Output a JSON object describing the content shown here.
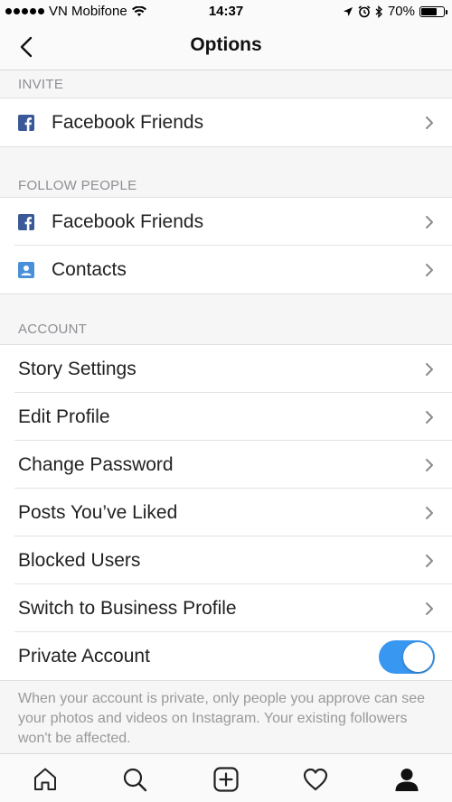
{
  "status_bar": {
    "carrier": "VN Mobifone",
    "time": "14:37",
    "battery": "70%",
    "battery_level": 0.7
  },
  "nav": {
    "title": "Options",
    "back_icon": "chevron-left-icon"
  },
  "sections": {
    "invite": {
      "header": "INVITE",
      "items": [
        {
          "label": "Facebook Friends",
          "icon": "facebook-icon"
        }
      ]
    },
    "follow_people": {
      "header": "FOLLOW PEOPLE",
      "items": [
        {
          "label": "Facebook Friends",
          "icon": "facebook-icon"
        },
        {
          "label": "Contacts",
          "icon": "contacts-icon"
        }
      ]
    },
    "account": {
      "header": "ACCOUNT",
      "items": [
        {
          "label": "Story Settings"
        },
        {
          "label": "Edit Profile"
        },
        {
          "label": "Change Password"
        },
        {
          "label": "Posts You’ve Liked"
        },
        {
          "label": "Blocked Users"
        },
        {
          "label": "Switch to Business Profile"
        }
      ],
      "private_account": {
        "label": "Private Account",
        "enabled": true
      },
      "footnote": "When your account is private, only people you approve can see your photos and videos on Instagram. Your existing followers won't be affected."
    }
  },
  "tab_bar": {
    "tabs": [
      "home-icon",
      "search-icon",
      "new-post-icon",
      "activity-heart-icon",
      "profile-icon"
    ],
    "active": "profile-icon"
  },
  "colors": {
    "accent": "#3897f0",
    "facebook": "#3b5998",
    "contacts": "#4a90d9"
  }
}
